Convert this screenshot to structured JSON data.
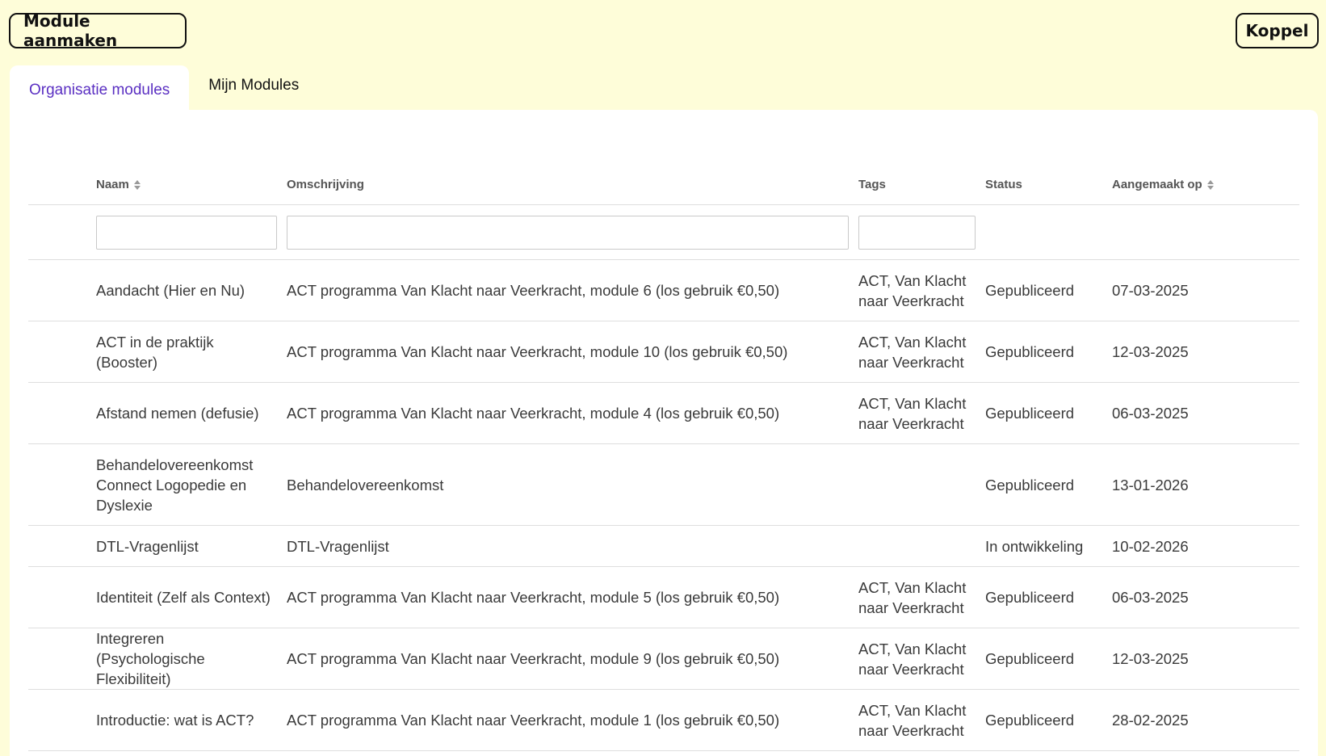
{
  "toolbar": {
    "create_label": "Module aanmaken",
    "link_label": "Koppel"
  },
  "tabs": [
    {
      "label": "Organisatie modules",
      "active": true
    },
    {
      "label": "Mijn Modules",
      "active": false
    }
  ],
  "table": {
    "columns": {
      "name": "Naam",
      "description": "Omschrijving",
      "tags": "Tags",
      "status": "Status",
      "created": "Aangemaakt op"
    },
    "filters": {
      "name": "",
      "description": "",
      "tags": ""
    },
    "rows": [
      {
        "name": "Aandacht (Hier en Nu)",
        "description": "ACT programma Van Klacht naar Veerkracht, module 6 (los gebruik €0,50)",
        "tags": "ACT, Van Klacht naar Veerkracht",
        "status": "Gepubliceerd",
        "created": "07-03-2025"
      },
      {
        "name": "ACT in de praktijk (Booster)",
        "description": "ACT programma Van Klacht naar Veerkracht, module 10 (los gebruik €0,50)",
        "tags": "ACT, Van Klacht naar Veerkracht",
        "status": "Gepubliceerd",
        "created": "12-03-2025"
      },
      {
        "name": "Afstand nemen (defusie)",
        "description": "ACT programma Van Klacht naar Veerkracht, module 4 (los gebruik €0,50)",
        "tags": "ACT, Van Klacht naar Veerkracht",
        "status": "Gepubliceerd",
        "created": "06-03-2025"
      },
      {
        "name": "Behandelovereenkomst Connect Logopedie en Dyslexie",
        "description": "Behandelovereenkomst",
        "tags": "",
        "status": "Gepubliceerd",
        "created": "13-01-2026"
      },
      {
        "name": "DTL-Vragenlijst",
        "description": "DTL-Vragenlijst",
        "tags": "",
        "status": "In ontwikkeling",
        "created": "10-02-2026"
      },
      {
        "name": "Identiteit (Zelf als Context)",
        "description": "ACT programma Van Klacht naar Veerkracht, module 5 (los gebruik €0,50)",
        "tags": "ACT, Van Klacht naar Veerkracht",
        "status": "Gepubliceerd",
        "created": "06-03-2025"
      },
      {
        "name": "Integreren (Psychologische Flexibiliteit)",
        "description": "ACT programma Van Klacht naar Veerkracht, module 9 (los gebruik €0,50)",
        "tags": "ACT, Van Klacht naar Veerkracht",
        "status": "Gepubliceerd",
        "created": "12-03-2025"
      },
      {
        "name": "Introductie: wat is ACT?",
        "description": "ACT programma Van Klacht naar Veerkracht, module 1 (los gebruik €0,50)",
        "tags": "ACT, Van Klacht naar Veerkracht",
        "status": "Gepubliceerd",
        "created": "28-02-2025"
      }
    ]
  },
  "colors": {
    "page_background": "#fefdd9",
    "active_tab_text": "#5a2fc2"
  }
}
